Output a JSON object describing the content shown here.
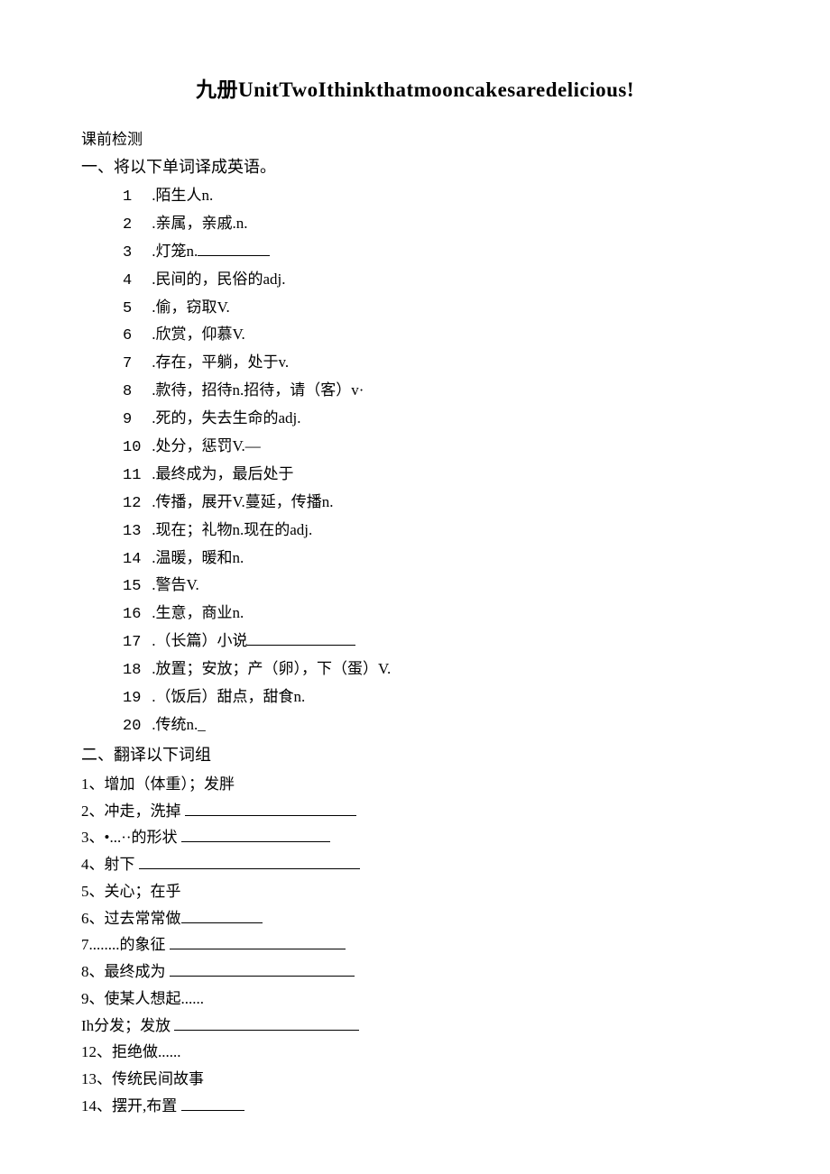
{
  "title": "九册UnitTwoIthinkthatmooncakesaredelicious!",
  "pretest_label": "课前检测",
  "section1": {
    "heading": "一、将以下单词译成英语。",
    "items": [
      {
        "num": "1",
        "text": ".陌生人n."
      },
      {
        "num": "2",
        "text": ".亲属，亲戚.n."
      },
      {
        "num": "3",
        "text": ".灯笼n.",
        "blank_after": 80
      },
      {
        "num": "4",
        "text": ".民间的，民俗的adj."
      },
      {
        "num": "5",
        "text": ".偷，窃取V."
      },
      {
        "num": "6",
        "text": ".欣赏，仰慕V."
      },
      {
        "num": "7",
        "text": ".存在，平躺，处于v."
      },
      {
        "num": "8",
        "text": ".款待，招待n.招待，请（客）v·"
      },
      {
        "num": "9",
        "text": ".死的，失去生命的adj."
      },
      {
        "num": "10",
        "text": ".处分，惩罚V.—"
      },
      {
        "num": "11",
        "text": ".最终成为，最后处于"
      },
      {
        "num": "12",
        "text": ".传播，展开V.蔓延，传播n."
      },
      {
        "num": "13",
        "text": ".现在；礼物n.现在的adj."
      },
      {
        "num": "14",
        "text": ".温暖，暖和n."
      },
      {
        "num": "15",
        "text": ".警告V."
      },
      {
        "num": "16",
        "text": ".生意，商业n."
      },
      {
        "num": "17",
        "text": ".（长篇）小说",
        "blank_after": 120
      },
      {
        "num": "18",
        "text": ".放置；安放；产（卵），下（蛋）V."
      },
      {
        "num": "19",
        "text": ".（饭后）甜点，甜食n."
      },
      {
        "num": "20",
        "text": ".传统n._"
      }
    ]
  },
  "section2": {
    "heading": "二、翻译以下词组",
    "items": [
      {
        "label": "1、增加（体重）；发胖"
      },
      {
        "label": "2、冲走，洗掉 ",
        "blank_after": 190
      },
      {
        "label": "3、•...··的形状 ",
        "blank_after": 165
      },
      {
        "label": "4、射下 ",
        "blank_after": 245
      },
      {
        "label": "5、关心；在乎"
      },
      {
        "label": "6、过去常常做",
        "blank_after": 90
      },
      {
        "label": "7........的象征 ",
        "blank_after": 195
      },
      {
        "label": "8、最终成为 ",
        "blank_after": 205
      },
      {
        "label": "9、使某人想起......"
      },
      {
        "label": "Ih分发；发放 ",
        "blank_after": 205
      },
      {
        "label": "12、拒绝做......"
      },
      {
        "label": "13、传统民间故事"
      },
      {
        "label": "14、摆开,布置 ",
        "blank_after": 70
      }
    ]
  }
}
